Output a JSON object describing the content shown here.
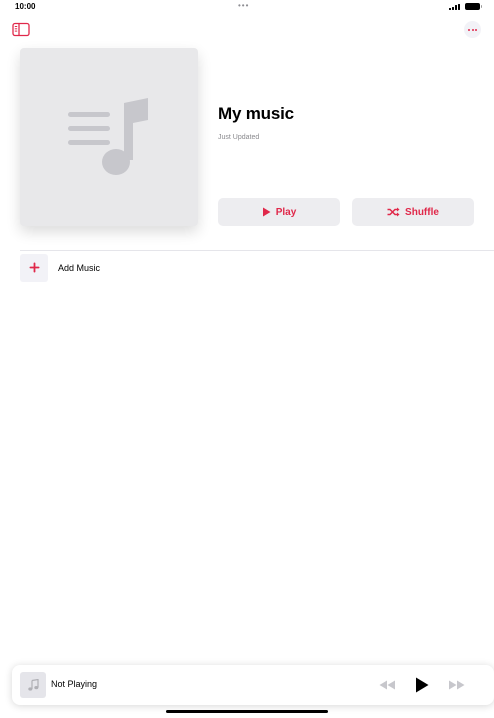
{
  "status_bar": {
    "time": "10:00",
    "center_dots": "•••"
  },
  "header": {
    "sidebar_icon": "sidebar-icon",
    "more_icon": "ellipsis-icon"
  },
  "playlist": {
    "title": "My music",
    "subtitle": "Just Updated",
    "artwork_icon": "music-note-icon",
    "play_label": "Play",
    "shuffle_label": "Shuffle"
  },
  "add_music": {
    "label": "Add Music",
    "icon": "plus-icon"
  },
  "mini_player": {
    "title": "Not Playing",
    "controls": [
      "rewind-icon",
      "play-icon",
      "fast-forward-icon"
    ]
  },
  "colors": {
    "accent": "#e0284a",
    "artwork_bg": "#e8e8ea",
    "artwork_glyph": "#c7c7cc",
    "button_bg": "#ededf0"
  }
}
